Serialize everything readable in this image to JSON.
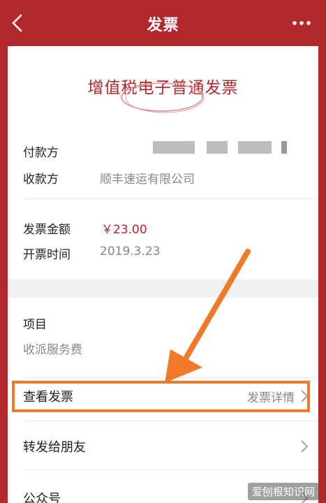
{
  "nav": {
    "title": "发票"
  },
  "invoice": {
    "title": "增值税电子普通发票",
    "payer_label": "付款方",
    "payee_label": "收款方",
    "payee_value": "顺丰速运有限公司",
    "amount_label": "发票金额",
    "amount_value": "￥23.00",
    "date_label": "开票时间",
    "date_value": "2019.3.23",
    "item_label": "项目",
    "item_value": "收派服务费"
  },
  "menu": [
    {
      "label": "查看发票",
      "right": "发票详情"
    },
    {
      "label": "转发给朋友",
      "right": ""
    },
    {
      "label": "公众号",
      "right": ""
    }
  ],
  "watermark": "爱刨根知识网",
  "colors": {
    "brand": "#b3282d",
    "highlight": "#f07a2a"
  }
}
